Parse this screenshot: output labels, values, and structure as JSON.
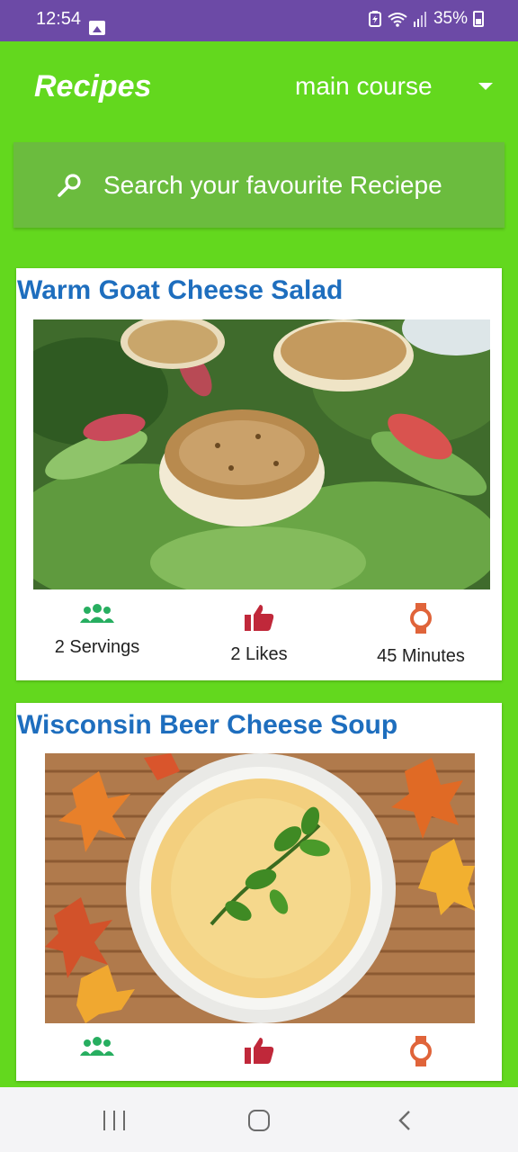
{
  "status_bar": {
    "time": "12:54",
    "battery_percent": "35%",
    "icons": [
      "gallery-icon",
      "battery-saver-icon",
      "wifi-icon",
      "signal-icon",
      "battery-icon"
    ]
  },
  "app_bar": {
    "title": "Recipes",
    "category": {
      "selected": "main course"
    }
  },
  "search": {
    "placeholder": "Search your favourite Reciepe",
    "icon": "search-icon"
  },
  "recipes": [
    {
      "title": "Warm Goat Cheese Salad",
      "servings": "2 Servings",
      "likes": "2 Likes",
      "time": "45 Minutes"
    },
    {
      "title": "Wisconsin Beer Cheese Soup"
    }
  ],
  "colors": {
    "background": "#63d81e",
    "status_bar": "#6c4aa6",
    "search_bar": "#6bbc3e",
    "card_title": "#1e6ebe",
    "servings_icon": "#27ae60",
    "likes_icon": "#c0283a",
    "time_icon": "#e0643a"
  },
  "nav_bar": {
    "buttons": [
      "recents-icon",
      "home-icon",
      "back-icon"
    ]
  }
}
